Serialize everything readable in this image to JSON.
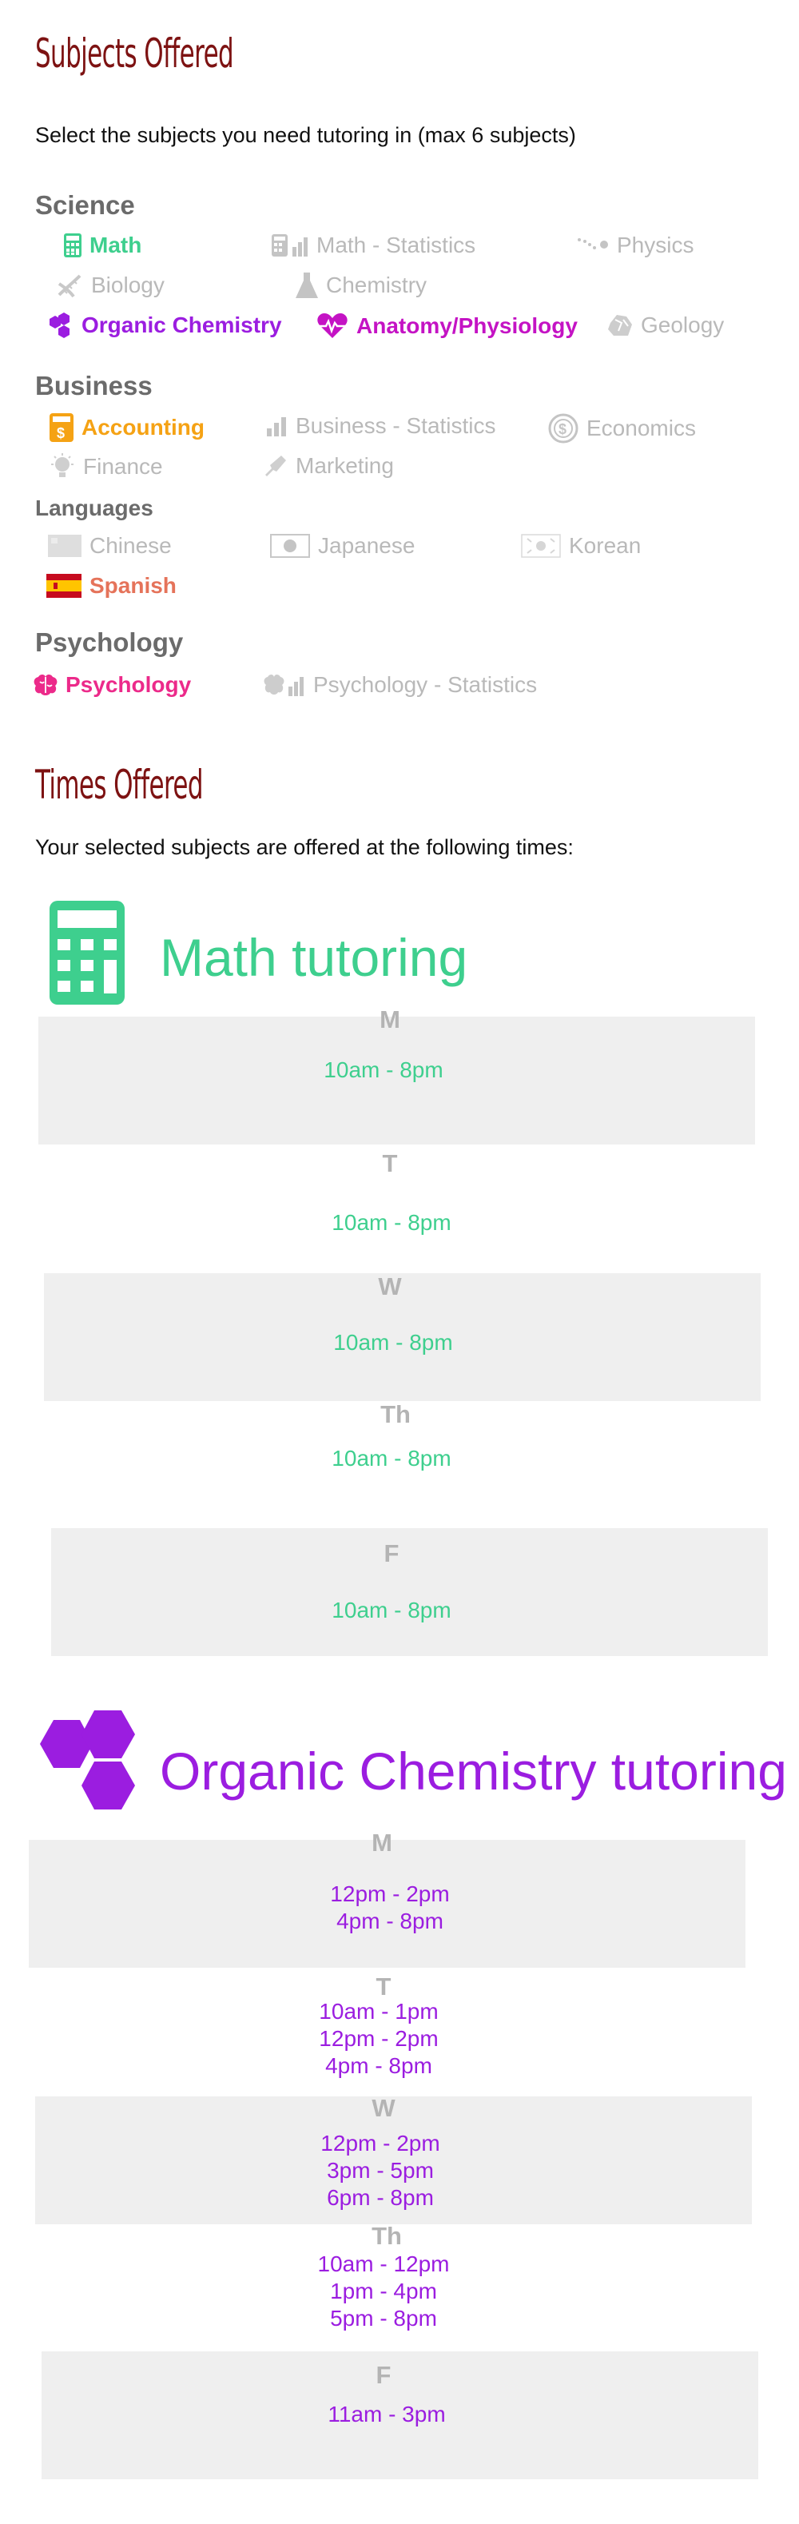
{
  "subjects_section": {
    "title": "Subjects Offered",
    "intro": "Select the subjects you need tutoring in (max 6 subjects)"
  },
  "categories": {
    "science": "Science",
    "business": "Business",
    "languages": "Languages",
    "psychology": "Psychology"
  },
  "subjects": {
    "math": "Math",
    "math_statistics": "Math - Statistics",
    "physics": "Physics",
    "biology": "Biology",
    "chemistry": "Chemistry",
    "organic_chemistry": "Organic Chemistry",
    "anatomy": "Anatomy/Physiology",
    "geology": "Geology",
    "accounting": "Accounting",
    "business_statistics": "Business - Statistics",
    "economics": "Economics",
    "finance": "Finance",
    "marketing": "Marketing",
    "chinese": "Chinese",
    "japanese": "Japanese",
    "korean": "Korean",
    "spanish": "Spanish",
    "psychology": "Psychology",
    "psychology_statistics": "Psychology - Statistics"
  },
  "selected_colors": {
    "math": "#3ecf8e",
    "organic_chemistry": "#9b1de0",
    "anatomy": "#c413c4",
    "accounting": "#f5a214",
    "spanish": "#e5735a",
    "psychology": "#ec2a8a",
    "unselected": "#b9b9b9"
  },
  "times_section": {
    "title": "Times Offered",
    "intro": "Your selected subjects are offered at the following times:"
  },
  "math_card": {
    "title": "Math tutoring",
    "icon": "calculator-icon",
    "days": [
      {
        "day": "M",
        "times": [
          "10am - 8pm"
        ]
      },
      {
        "day": "T",
        "times": [
          "10am - 8pm"
        ]
      },
      {
        "day": "W",
        "times": [
          "10am - 8pm"
        ]
      },
      {
        "day": "Th",
        "times": [
          "10am - 8pm"
        ]
      },
      {
        "day": "F",
        "times": [
          "10am - 8pm"
        ]
      }
    ]
  },
  "ochem_card": {
    "title": "Organic Chemistry tutoring",
    "icon": "hexagons-icon",
    "days": [
      {
        "day": "M",
        "times": [
          "12pm - 2pm",
          "4pm - 8pm"
        ]
      },
      {
        "day": "T",
        "times": [
          "10am - 1pm",
          "12pm - 2pm",
          "4pm - 8pm"
        ]
      },
      {
        "day": "W",
        "times": [
          "12pm - 2pm",
          "3pm - 5pm",
          "6pm - 8pm"
        ]
      },
      {
        "day": "Th",
        "times": [
          "10am - 12pm",
          "1pm - 4pm",
          "5pm - 8pm"
        ]
      },
      {
        "day": "F",
        "times": [
          "11am - 3pm"
        ]
      }
    ]
  }
}
